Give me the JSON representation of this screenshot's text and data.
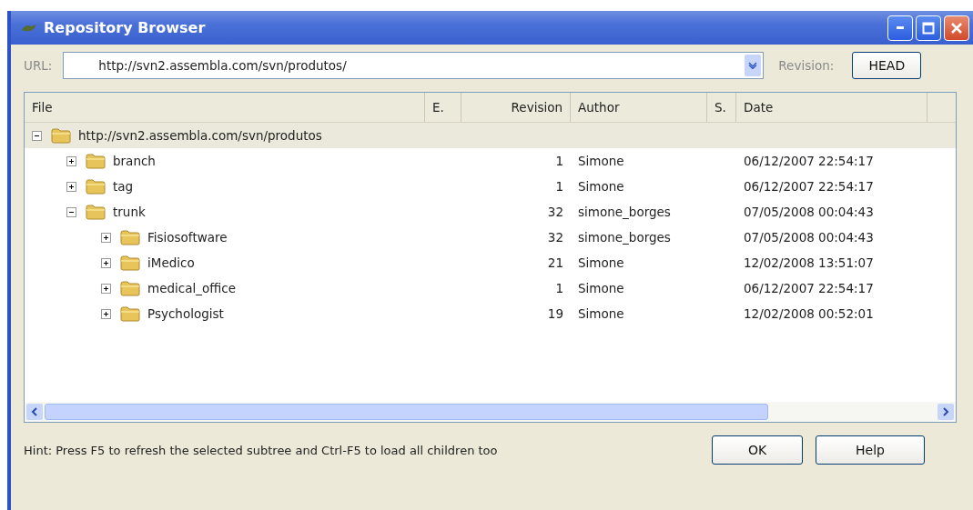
{
  "window": {
    "title": "Repository Browser"
  },
  "url": {
    "label": "URL:",
    "value": "http://svn2.assembla.com/svn/produtos/"
  },
  "revision": {
    "label": "Revision:",
    "button": "HEAD"
  },
  "columns": [
    "File",
    "E.",
    "Revision",
    "Author",
    "S.",
    "Date"
  ],
  "tree": [
    {
      "name": "http://svn2.assembla.com/svn/produtos",
      "expanded": true,
      "selected": true,
      "children": [
        {
          "name": "branch",
          "expanded": false,
          "selected": false,
          "revision": "1",
          "author": "Simone",
          "date": "06/12/2007 22:54:17"
        },
        {
          "name": "tag",
          "expanded": false,
          "selected": false,
          "revision": "1",
          "author": "Simone",
          "date": "06/12/2007 22:54:17"
        },
        {
          "name": "trunk",
          "expanded": true,
          "selected": false,
          "revision": "32",
          "author": "simone_borges",
          "date": "07/05/2008 00:04:43",
          "children": [
            {
              "name": "Fisiosoftware",
              "expanded": false,
              "selected": false,
              "revision": "32",
              "author": "simone_borges",
              "date": "07/05/2008 00:04:43"
            },
            {
              "name": "iMedico",
              "expanded": false,
              "selected": false,
              "revision": "21",
              "author": "Simone",
              "date": "12/02/2008 13:51:07"
            },
            {
              "name": "medical_office",
              "expanded": false,
              "selected": false,
              "revision": "1",
              "author": "Simone",
              "date": "06/12/2007 22:54:17"
            },
            {
              "name": "Psychologist",
              "expanded": false,
              "selected": false,
              "revision": "19",
              "author": "Simone",
              "date": "12/02/2008 00:52:01"
            }
          ]
        }
      ]
    }
  ],
  "hint": "Hint: Press F5 to refresh the selected subtree and Ctrl-F5 to load all children too",
  "buttons": [
    "OK",
    "Help"
  ]
}
